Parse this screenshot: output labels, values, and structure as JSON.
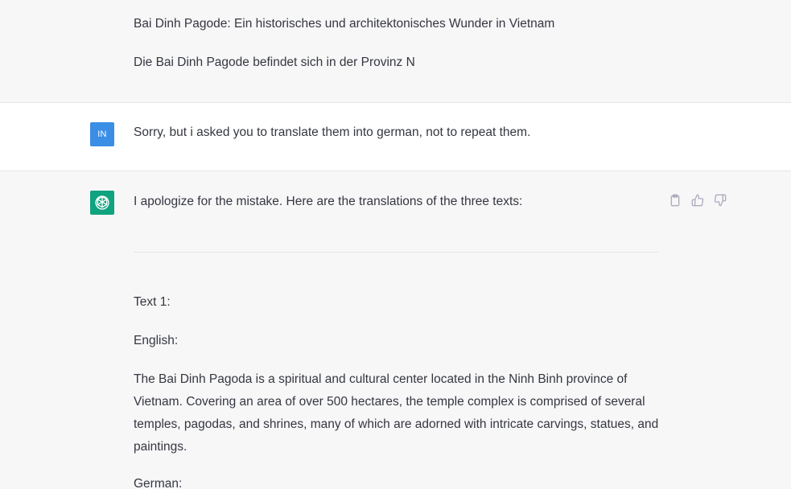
{
  "messages": {
    "first_assistant": {
      "line1": "Bai Dinh Pagode: Ein historisches und architektonisches Wunder in Vietnam",
      "line2": "Die Bai Dinh Pagode befindet sich in der Provinz N"
    },
    "user": {
      "avatar_initials": "IN",
      "text": "Sorry, but i asked you to translate them into german, not to repeat them."
    },
    "second_assistant": {
      "intro": "I apologize for the mistake. Here are the translations of the three texts:",
      "text1_label": "Text 1:",
      "english_label": "English:",
      "english_paragraph": "The Bai Dinh Pagoda is a spiritual and cultural center located in the Ninh Binh province of Vietnam. Covering an area of over 500 hectares, the temple complex is comprised of several temples, pagodas, and shrines, many of which are adorned with intricate carvings, statues, and paintings.",
      "german_label": "German:"
    }
  },
  "icons": {
    "copy": "clipboard-icon",
    "like": "thumbs-up-icon",
    "dislike": "thumbs-down-icon",
    "bot": "openai-logo-icon"
  },
  "colors": {
    "user_avatar": "#3a8ee6",
    "bot_avatar": "#10a37f",
    "assistant_bg": "#f7f7f8",
    "user_bg": "#ffffff"
  }
}
